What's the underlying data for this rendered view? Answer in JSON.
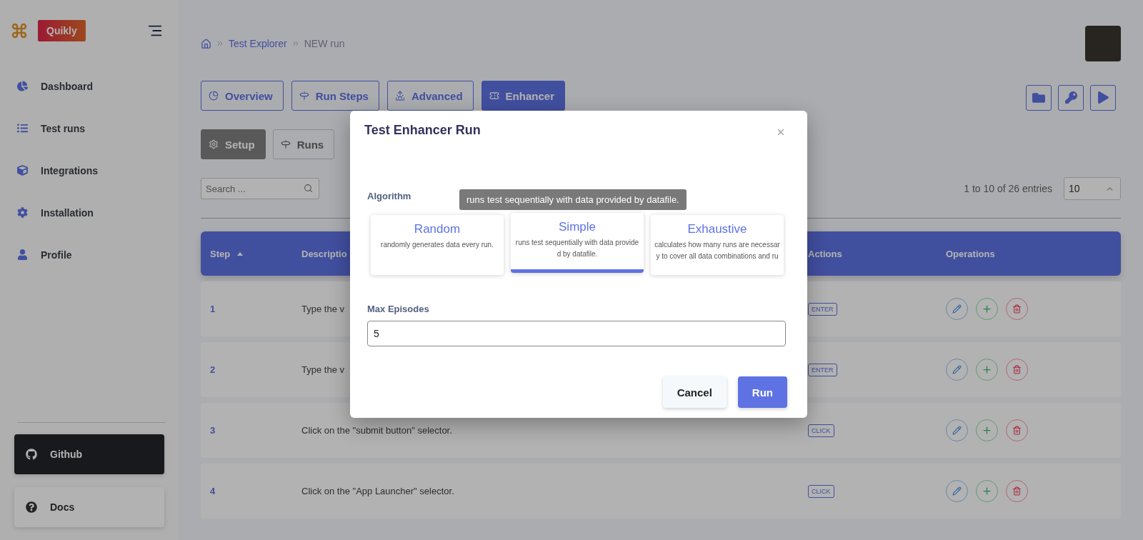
{
  "sidebar": {
    "brand": "Quikly",
    "items": [
      {
        "label": "Dashboard",
        "kind": "dashboard"
      },
      {
        "label": "Test runs",
        "kind": "runs"
      },
      {
        "label": "Integrations",
        "kind": "integrations"
      },
      {
        "label": "Installation",
        "kind": "installation"
      },
      {
        "label": "Profile",
        "kind": "profile"
      }
    ],
    "links": [
      {
        "label": "Github",
        "kind": "github"
      },
      {
        "label": "Docs",
        "kind": "docs"
      }
    ]
  },
  "breadcrumb": [
    "Test Explorer",
    "NEW run"
  ],
  "tabs": [
    {
      "label": "Overview",
      "kind": "overview",
      "selected": false
    },
    {
      "label": "Run Steps",
      "kind": "steps",
      "selected": false
    },
    {
      "label": "Advanced",
      "kind": "advanced",
      "selected": false
    },
    {
      "label": "Enhancer",
      "kind": "enhancer",
      "selected": true
    }
  ],
  "subtabs": [
    {
      "label": "Setup",
      "kind": "setup",
      "selected": true
    },
    {
      "label": "Runs",
      "kind": "runs",
      "selected": false
    }
  ],
  "search": {
    "placeholder": "Search ..."
  },
  "pagination": {
    "summary": "1 to 10 of 26 entries",
    "page_size": "10"
  },
  "table": {
    "columns": [
      {
        "label": "Step",
        "sorted": true
      },
      {
        "label": "Descriptio",
        "sorted": false
      },
      {
        "label": "Actions",
        "sorted": false
      },
      {
        "label": "Operations",
        "sorted": false
      }
    ],
    "rows": [
      {
        "step": "1",
        "description": "Type the v",
        "action": "ENTER"
      },
      {
        "step": "2",
        "description": "Type the v",
        "action": "ENTER"
      },
      {
        "step": "3",
        "description": "Click on the \"submit button\" selector.",
        "action": "CLICK"
      },
      {
        "step": "4",
        "description": "Click on the \"App Launcher\" selector.",
        "action": "CLICK"
      }
    ]
  },
  "modal": {
    "title": "Test Enhancer Run",
    "algorithm_label": "Algorithm",
    "algorithms": [
      {
        "name": "Random",
        "description": "randomly generates data every run.",
        "selected": false
      },
      {
        "name": "Simple",
        "description": "runs test sequentially with data provided by datafile.",
        "selected": true
      },
      {
        "name": "Exhaustive",
        "description": "calculates how many runs are necessary to cover all data combinations and ru",
        "selected": false
      }
    ],
    "tooltip": "runs test sequentially with data provided by datafile.",
    "max_episodes_label": "Max Episodes",
    "max_episodes": "5",
    "buttons": [
      {
        "label": "Cancel",
        "kind": "secondary"
      },
      {
        "label": "Run",
        "kind": "primary"
      }
    ]
  }
}
